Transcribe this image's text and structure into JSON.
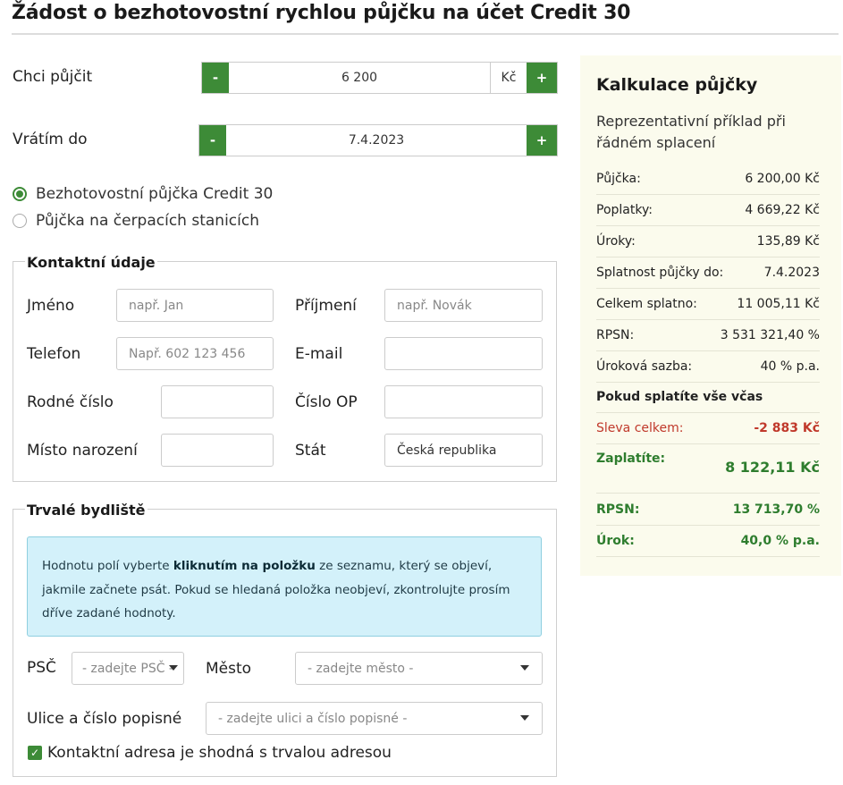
{
  "page_title": "Žádost o bezhotovostní rychlou půjčku na účet Credit 30",
  "loan": {
    "amount_label": "Chci půjčit",
    "amount_value": "6 200",
    "amount_unit": "Kč",
    "repay_label": "Vrátím do",
    "repay_value": "7.4.2023",
    "minus": "-",
    "plus": "+"
  },
  "loan_type": {
    "options": [
      "Bezhotovostní půjčka Credit 30",
      "Půjčka na čerpacích stanicích"
    ],
    "selected": 0
  },
  "contact": {
    "legend": "Kontaktní údaje",
    "first_name_label": "Jméno",
    "first_name_placeholder": "např. Jan",
    "last_name_label": "Příjmení",
    "last_name_placeholder": "např. Novák",
    "phone_label": "Telefon",
    "phone_placeholder": "Např. 602 123 456",
    "email_label": "E-mail",
    "email_value": "",
    "birth_number_label": "Rodné číslo",
    "birth_number_value": "",
    "id_card_label": "Číslo OP",
    "id_card_value": "",
    "birth_place_label": "Místo narození",
    "birth_place_value": "",
    "country_label": "Stát",
    "country_value": "Česká republika"
  },
  "address": {
    "legend": "Trvalé bydliště",
    "info_pre": "Hodnotu polí vyberte ",
    "info_bold": "kliknutím na položku",
    "info_post": " ze seznamu, který se objeví, jakmile začnete psát. Pokud se hledaná položka neobjeví, zkontrolujte prosím dříve zadané hodnoty.",
    "psc_label": "PSČ",
    "psc_placeholder": "- zadejte PSČ -",
    "city_label": "Město",
    "city_placeholder": "- zadejte město -",
    "street_label": "Ulice a číslo popisné",
    "street_placeholder": "- zadejte ulici a číslo popisné -",
    "same_address_label": "Kontaktní adresa je shodná s trvalou adresou",
    "same_address_checked": true
  },
  "calculation": {
    "title": "Kalkulace půjčky",
    "subtitle": "Reprezentativní příklad při řádném splacení",
    "rows": [
      {
        "k": "Půjčka:",
        "v": "6 200,00 Kč"
      },
      {
        "k": "Poplatky:",
        "v": "4 669,22 Kč"
      },
      {
        "k": "Úroky:",
        "v": "135,89 Kč"
      },
      {
        "k": "Splatnost půjčky do:",
        "v": "7.4.2023"
      },
      {
        "k": "Celkem splatno:",
        "v": "11 005,11 Kč"
      },
      {
        "k": "RPSN:",
        "v": "3 531 321,40 %"
      },
      {
        "k": "Úroková sazba:",
        "v": "40 % p.a."
      }
    ],
    "on_time_heading": "Pokud splatíte vše včas",
    "discount_label": "Sleva celkem:",
    "discount_value": "-2 883 Kč",
    "pay_label": "Zaplatíte:",
    "pay_value": "8 122,11 Kč",
    "rpsn_label": "RPSN:",
    "rpsn_value": "13 713,70 %",
    "interest_label": "Úrok:",
    "interest_value": "40,0 % p.a."
  },
  "colors": {
    "accent": "#3d8b37",
    "info_bg": "#d3f1fa",
    "panel_bg": "#fbfbed",
    "discount": "#c0392b"
  }
}
